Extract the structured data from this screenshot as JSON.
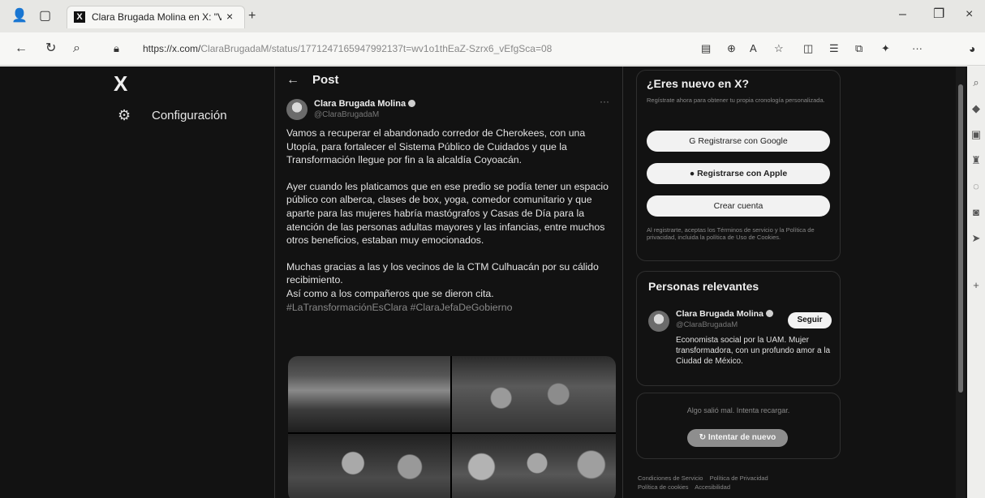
{
  "browser": {
    "tab_title": "Clara Brugada Molina en X: \"Vai",
    "tab_favicon": "X",
    "tab_close": "×",
    "new_tab": "+",
    "url_host": "https://x.com/",
    "url_path": "ClaraBrugadaM/status/1771247165947992137t=wv1o1thEaZ-Szrx6_vEfgSca=08",
    "window_controls": [
      "–",
      "❐",
      "×"
    ],
    "toolbar_icons": [
      "reader-icon",
      "zoom-icon",
      "read-aloud-icon",
      "favorite-icon",
      "split-icon",
      "favorites-bar-icon",
      "collections-icon",
      "extensions-icon",
      "more-icon"
    ]
  },
  "sidebar": {
    "logo": "X",
    "items": [
      {
        "label": "Configuración",
        "icon": "gear-icon"
      }
    ]
  },
  "post": {
    "header_title": "Post",
    "author_name": "Clara Brugada Molina",
    "author_handle": "@ClaraBrugadaM",
    "more": "···",
    "paragraphs": [
      "Vamos a recuperar el abandonado corredor de Cherokees, con una Utopía, para fortalecer el Sistema Público de Cuidados y que la Transformación llegue por fin a la alcaldía Coyoacán.",
      "Ayer cuando les platicamos que en ese predio se podía tener un espacio público con alberca, clases de box, yoga, comedor comunitario y que aparte para las mujeres habría mastógrafos y Casas de Día para la atención de las personas adultas mayores y las infancias, entre muchos otros beneficios, estaban muy emocionados.",
      "Muchas gracias a las y los vecinos de la CTM Culhuacán por su cálido recibimiento.",
      "Así como a los compañeros que se dieron cita."
    ],
    "hashtags": "#LaTransformaciónEsClara #ClaraJefaDeGobierno"
  },
  "signup": {
    "title": "¿Eres nuevo en X?",
    "subtitle": "Regístrate ahora para obtener tu propia cronología personalizada.",
    "google_button": "Registrarse con Google",
    "apple_button": "Registrarse con Apple",
    "create_button": "Crear cuenta",
    "legal": "Al registrarte, aceptas los Términos de servicio y la Política de privacidad, incluida la política de Uso de Cookies."
  },
  "relevant": {
    "title": "Personas relevantes",
    "name": "Clara Brugada Molina",
    "handle": "@ClaraBrugadaM",
    "follow_button": "Seguir",
    "bio": "Economista social por la UAM. Mujer transformadora, con un profundo amor a la Ciudad de México."
  },
  "error_box": {
    "message": "Algo salió mal. Intenta recargar.",
    "retry_button": "Intentar de nuevo"
  },
  "footer": {
    "links": [
      "Condiciones de Servicio",
      "Política de Privacidad",
      "Política de cookies",
      "Accesibilidad"
    ]
  }
}
